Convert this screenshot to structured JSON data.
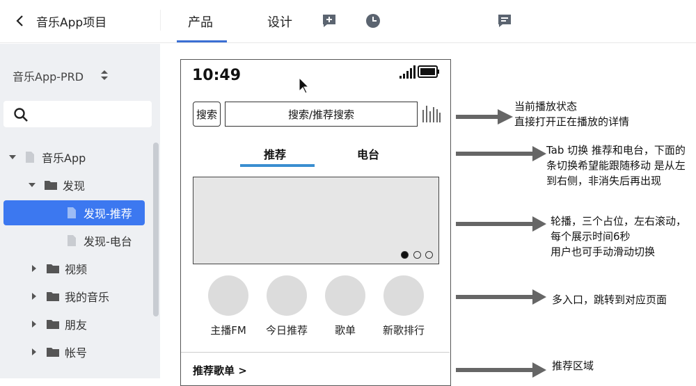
{
  "header": {
    "project_title": "音乐App项目",
    "tabs": [
      "产品",
      "设计"
    ],
    "active_tab": "产品",
    "icons": [
      "back-icon",
      "add-comment-icon",
      "history-icon",
      "comment-icon"
    ]
  },
  "sidebar": {
    "doc_name": "音乐App-PRD",
    "search_placeholder": "",
    "tree": [
      {
        "label": "音乐App",
        "type": "doc",
        "level": 0,
        "expanded": true
      },
      {
        "label": "发现",
        "type": "folder",
        "level": 1,
        "expanded": true
      },
      {
        "label": "发现-推荐",
        "type": "doc",
        "level": 2,
        "selected": true
      },
      {
        "label": "发现-电台",
        "type": "doc",
        "level": 2
      },
      {
        "label": "视频",
        "type": "folder",
        "level": 1
      },
      {
        "label": "我的音乐",
        "type": "folder",
        "level": 1
      },
      {
        "label": "朋友",
        "type": "folder",
        "level": 1
      },
      {
        "label": "帐号",
        "type": "folder",
        "level": 1
      }
    ]
  },
  "phone": {
    "time": "10:49",
    "search_button": "搜索",
    "search_field": "搜索/推荐搜索",
    "tabs": [
      "推荐",
      "电台"
    ],
    "entries": [
      "主播FM",
      "今日推荐",
      "歌单",
      "新歌排行"
    ],
    "rec_list": "推荐歌单 >"
  },
  "annotations": [
    {
      "lines": [
        "当前播放状态",
        "直接打开正在播放的详情"
      ]
    },
    {
      "lines": [
        "Tab 切换 推荐和电台，下面的",
        "条切换希望能跟随移动 是从左",
        "到右侧，非消失后再出现"
      ]
    },
    {
      "lines": [
        "轮播，三个占位，左右滚动，",
        "每个展示时间6秒",
        "用户也可手动滑动切换"
      ]
    },
    {
      "lines": [
        "多入口，跳转到对应页面"
      ]
    },
    {
      "lines": [
        "推荐区域"
      ]
    }
  ],
  "colors": {
    "accent": "#3c78f0",
    "tab_underline": "#3a8ed0",
    "sidebar_bg": "#eef0f3"
  }
}
